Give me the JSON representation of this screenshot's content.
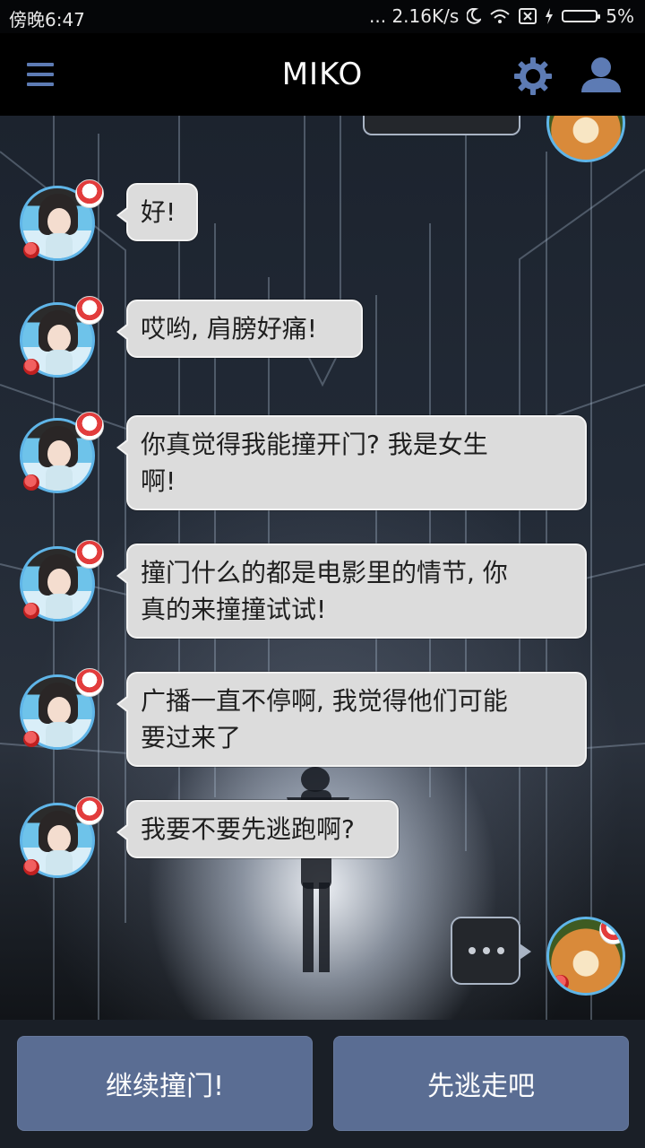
{
  "status_bar": {
    "time": "傍晚6:47",
    "network_speed": "... 2.16K/s",
    "battery": "5%",
    "battery_level": 0.05
  },
  "header": {
    "title": "MIKO",
    "menu_icon": "hamburger-menu-icon",
    "settings_icon": "gear-icon",
    "profile_icon": "person-icon"
  },
  "chat": {
    "messages": [
      {
        "sender": "miko",
        "text_lines": [
          "好!"
        ]
      },
      {
        "sender": "miko",
        "text_lines": [
          "哎哟, 肩膀好痛!"
        ]
      },
      {
        "sender": "miko",
        "text_lines": [
          "你真觉得我能撞开门? 我是女生",
          "啊!"
        ]
      },
      {
        "sender": "miko",
        "text_lines": [
          "撞门什么的都是电影里的情节, 你",
          "真的来撞撞试试!"
        ]
      },
      {
        "sender": "miko",
        "text_lines": [
          "广播一直不停啊, 我觉得他们可能",
          "要过来了"
        ]
      },
      {
        "sender": "miko",
        "text_lines": [
          "我要不要先逃跑啊?"
        ]
      }
    ],
    "typing_indicator": "..."
  },
  "choices": [
    {
      "label": "继续撞门!"
    },
    {
      "label": "先逃走吧"
    }
  ],
  "colors": {
    "accent_blue": "#5d7bb4",
    "button_bg": "#5a6d93",
    "bubble_bg": "#dcdcdc",
    "avatar_ring": "#5fb5e8"
  }
}
